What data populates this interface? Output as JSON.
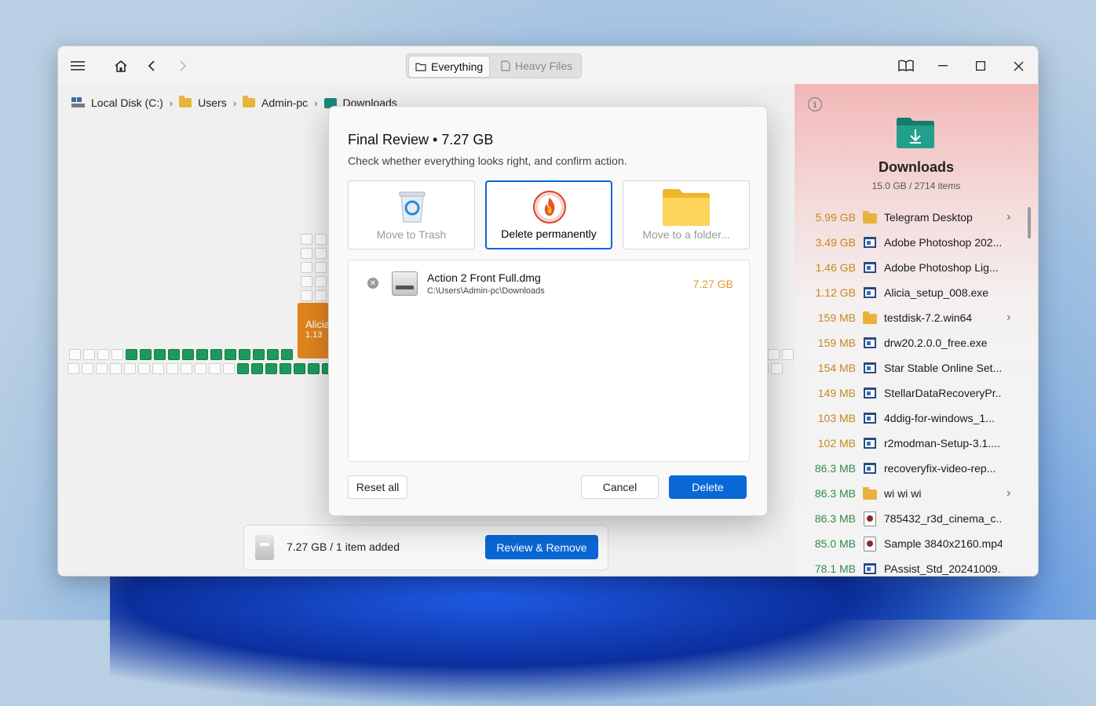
{
  "toolbar": {
    "segment": [
      {
        "label": "Everything",
        "icon": "folder-icon",
        "active": true
      },
      {
        "label": "Heavy Files",
        "icon": "file-icon",
        "active": false
      }
    ]
  },
  "breadcrumb": [
    {
      "label": "Local Disk (C:)",
      "icon": "drive-icon"
    },
    {
      "label": "Users",
      "icon": "folder-icon"
    },
    {
      "label": "Admin-pc",
      "icon": "folder-icon"
    },
    {
      "label": "Downloads",
      "icon": "downloads-folder-icon"
    }
  ],
  "map": {
    "orange_label": "Alicia_setup_008.exe",
    "orange_size": "1.13"
  },
  "bottom_bar": {
    "summary": "7.27 GB / 1 item added",
    "button": "Review & Remove"
  },
  "panel": {
    "title": "Downloads",
    "subtitle": "15.0 GB / 2714 items",
    "items": [
      {
        "size": "5.99 GB",
        "name": "Telegram Desktop",
        "type": "folder",
        "color": "#c8861a"
      },
      {
        "size": "3.49 GB",
        "name": "Adobe Photoshop 202...",
        "type": "exe",
        "color": "#c8861a"
      },
      {
        "size": "1.46 GB",
        "name": "Adobe Photoshop Lig...",
        "type": "exe",
        "color": "#c8861a"
      },
      {
        "size": "1.12 GB",
        "name": "Alicia_setup_008.exe",
        "type": "exe",
        "color": "#c8861a"
      },
      {
        "size": "159 MB",
        "name": "testdisk-7.2.win64",
        "type": "folder",
        "color": "#c8861a"
      },
      {
        "size": "159 MB",
        "name": "drw20.2.0.0_free.exe",
        "type": "exe",
        "color": "#c8861a"
      },
      {
        "size": "154 MB",
        "name": "Star Stable Online Set...",
        "type": "exe",
        "color": "#c8861a"
      },
      {
        "size": "149 MB",
        "name": "StellarDataRecoveryPr...",
        "type": "exe",
        "color": "#c8861a"
      },
      {
        "size": "103 MB",
        "name": "4ddig-for-windows_1...",
        "type": "exe",
        "color": "#c8861a"
      },
      {
        "size": "102 MB",
        "name": "r2modman-Setup-3.1....",
        "type": "exe",
        "color": "#c8861a"
      },
      {
        "size": "86.3 MB",
        "name": "recoveryfix-video-rep...",
        "type": "exe",
        "color": "#2e8b4a"
      },
      {
        "size": "86.3 MB",
        "name": "wi wi wi",
        "type": "folder",
        "color": "#2e8b4a"
      },
      {
        "size": "86.3 MB",
        "name": "785432_r3d_cinema_c...",
        "type": "video",
        "color": "#2e8b4a"
      },
      {
        "size": "85.0 MB",
        "name": "Sample 3840x2160.mp4",
        "type": "video",
        "color": "#2e8b4a"
      },
      {
        "size": "78.1 MB",
        "name": "PAssist_Std_20241009....",
        "type": "exe",
        "color": "#2e8b4a"
      }
    ]
  },
  "dialog": {
    "title": "Final Review • 7.27 GB",
    "subtitle": "Check whether everything looks right, and confirm action.",
    "options": [
      {
        "label": "Move to Trash",
        "icon": "recycle-bin-icon",
        "selected": false
      },
      {
        "label": "Delete permanently",
        "icon": "fire-icon",
        "selected": true
      },
      {
        "label": "Move to a folder...",
        "icon": "folder-icon",
        "selected": false
      }
    ],
    "file": {
      "name": "Action 2 Front Full.dmg",
      "path": "C:\\Users\\Admin-pc\\Downloads",
      "size": "7.27 GB"
    },
    "reset_label": "Reset all",
    "cancel_label": "Cancel",
    "delete_label": "Delete"
  },
  "colors": {
    "accent": "#0a67d6",
    "green": "#1c9a5c",
    "orange": "#e0841e"
  }
}
